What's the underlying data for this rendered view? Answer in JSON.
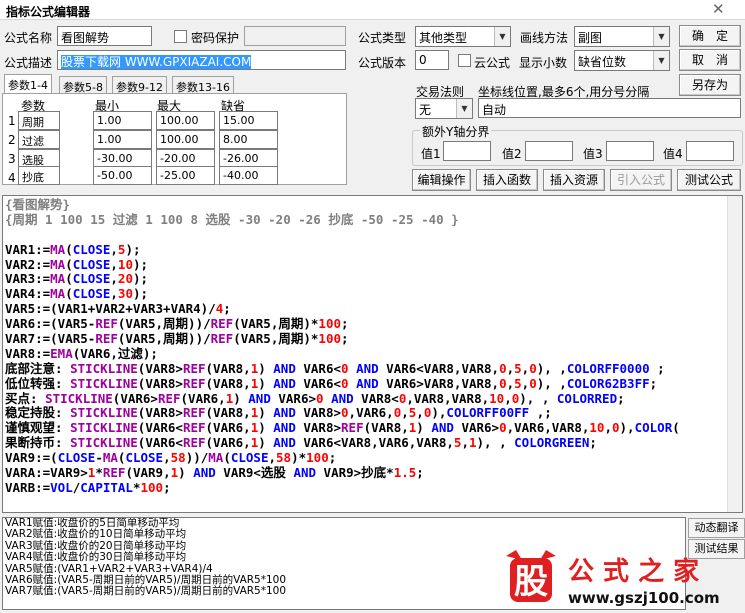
{
  "window": {
    "title": "指标公式编辑器",
    "close_glyph": "✕"
  },
  "form": {
    "name_label": "公式名称",
    "name_value": "看图解势",
    "password_label": "密码保护",
    "desc_label": "公式描述",
    "desc_value": "股票下载网 WWW.GPXIAZAI.COM",
    "type_label": "公式类型",
    "type_value": "其他类型",
    "draw_label": "画线方法",
    "draw_value": "副图",
    "version_label": "公式版本",
    "version_value": "0",
    "cloud_label": "云公式",
    "decimal_label": "显示小数",
    "decimal_value": "缺省位数",
    "trade_label": "交易法则",
    "trade_value": "无",
    "coord_label": "坐标线位置,最多6个,用分号分隔",
    "coord_value": "自动",
    "yaxis_label": "额外Y轴分界",
    "y1": "值1",
    "y2": "值2",
    "y3": "值3",
    "y4": "值4"
  },
  "buttons": {
    "ok": "确　定",
    "cancel": "取　消",
    "saveas": "另存为",
    "edit": "编辑操作",
    "insert_func": "插入函数",
    "insert_res": "插入资源",
    "import": "引入公式",
    "test": "测试公式"
  },
  "tabs": [
    "参数1-4",
    "参数5-8",
    "参数9-12",
    "参数13-16"
  ],
  "params": {
    "headers": [
      "参数",
      "最小",
      "最大",
      "缺省"
    ],
    "rows": [
      {
        "n": "1",
        "name": "周期",
        "min": "1.00",
        "max": "100.00",
        "def": "15.00"
      },
      {
        "n": "2",
        "name": "过滤",
        "min": "1.00",
        "max": "100.00",
        "def": "8.00"
      },
      {
        "n": "3",
        "name": "选股",
        "min": "-30.00",
        "max": "-20.00",
        "def": "-26.00"
      },
      {
        "n": "4",
        "name": "抄底",
        "min": "-50.00",
        "max": "-25.00",
        "def": "-40.00"
      }
    ]
  },
  "code_lines": [
    "{看图解势}",
    "{周期 1 100 15 过滤 1 100 8 选股 -30 -20 -26 抄底 -50 -25 -40 }",
    "",
    "VAR1:=MA(CLOSE,5);",
    "VAR2:=MA(CLOSE,10);",
    "VAR3:=MA(CLOSE,20);",
    "VAR4:=MA(CLOSE,30);",
    "VAR5:=(VAR1+VAR2+VAR3+VAR4)/4;",
    "VAR6:=(VAR5-REF(VAR5,周期))/REF(VAR5,周期)*100;",
    "VAR7:=(VAR5-REF(VAR5,周期))/REF(VAR5,周期)*100;",
    "VAR8:=EMA(VAR6,过滤);",
    "底部注意: STICKLINE(VAR8>REF(VAR8,1) AND VAR6<0 AND VAR6<VAR8,VAR8,0,5,0), ,COLORFF0000 ;",
    "低位转强: STICKLINE(VAR8>REF(VAR8,1) AND VAR6<0 AND VAR6>VAR8,VAR8,0,5,0), ,COLOR62B3FF;",
    "买点: STICKLINE(VAR6>REF(VAR6,1) AND VAR6>0 AND VAR8<0,VAR8,VAR8,10,0), , COLORRED;",
    "稳定持股: STICKLINE(VAR8>REF(VAR8,1) AND VAR8>0,VAR6,0,5,0),COLORFF00FF ,;",
    "谨慎观望: STICKLINE(VAR6<REF(VAR6,1) AND VAR8>REF(VAR8,1) AND VAR6>0,VAR6,VAR8,10,0),COLOR(",
    "果断持币: STICKLINE(VAR6<REF(VAR6,1) AND VAR6<VAR8,VAR6,VAR8,5,1), , COLORGREEN;",
    "VAR9:=(CLOSE-MA(CLOSE,58))/MA(CLOSE,58)*100;",
    "VARA:=VAR9>1*REF(VAR9,1) AND VAR9<选股 AND VAR9>抄底*1.5;",
    "VARB:=VOL/CAPITAL*100;"
  ],
  "output_lines": [
    "VAR1赋值:收盘价的5日简单移动平均",
    "VAR2赋值:收盘价的10日简单移动平均",
    "VAR3赋值:收盘价的20日简单移动平均",
    "VAR4赋值:收盘价的30日简单移动平均",
    "VAR5赋值:(VAR1+VAR2+VAR3+VAR4)/4",
    "VAR6赋值:(VAR5-周期日前的VAR5)/周期日前的VAR5*100",
    "VAR7赋值:(VAR5-周期日前的VAR5)/周期日前的VAR5*100"
  ],
  "side": {
    "dynamic": "动态翻译",
    "test_result": "测试结果"
  },
  "logo": {
    "text": "公式之家",
    "url": "www.gszj100.com",
    "char": "股"
  },
  "colors": {
    "keyword": "#0000ff",
    "number": "#ff0000",
    "func": "#a000a0",
    "comment": "#808080",
    "logo_red": "#e02020"
  }
}
